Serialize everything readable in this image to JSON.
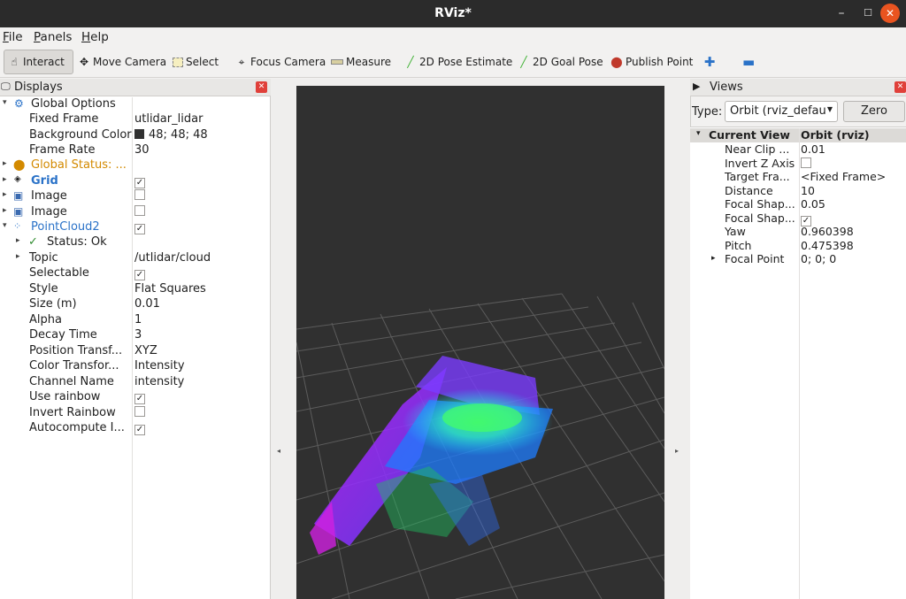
{
  "window": {
    "title": "RViz*"
  },
  "menu": [
    "File",
    "Panels",
    "Help"
  ],
  "toolbar": {
    "interact": "Interact",
    "move_camera": "Move Camera",
    "select": "Select",
    "focus_camera": "Focus Camera",
    "measure": "Measure",
    "pose_estimate": "2D Pose Estimate",
    "goal_pose": "2D Goal Pose",
    "publish_point": "Publish Point"
  },
  "displays": {
    "title": "Displays",
    "global_options": "Global Options",
    "fixed_frame_label": "Fixed Frame",
    "fixed_frame": "utlidar_lidar",
    "background_color_label": "Background Color",
    "background_color": "48; 48; 48",
    "frame_rate_label": "Frame Rate",
    "frame_rate": "30",
    "global_status": "Global Status: ...",
    "grid": "Grid",
    "image1": "Image",
    "image2": "Image",
    "pointcloud": "PointCloud2",
    "status": "Status: Ok",
    "topic_label": "Topic",
    "topic": "/utlidar/cloud",
    "selectable_label": "Selectable",
    "style_label": "Style",
    "style": "Flat Squares",
    "size_label": "Size (m)",
    "size": "0.01",
    "alpha_label": "Alpha",
    "alpha": "1",
    "decay_label": "Decay Time",
    "decay": "3",
    "position_label": "Position Transf...",
    "position": "XYZ",
    "color_label": "Color Transfor...",
    "color": "Intensity",
    "channel_label": "Channel Name",
    "channel": "intensity",
    "use_rainbow_label": "Use rainbow",
    "invert_rainbow_label": "Invert Rainbow",
    "autocompute_label": "Autocompute I..."
  },
  "views": {
    "title": "Views",
    "type_label": "Type:",
    "type_value": "Orbit (rviz_defau",
    "zero": "Zero",
    "current_view": "Current View",
    "current_view_type": "Orbit (rviz)",
    "rows": [
      {
        "label": "Near Clip ...",
        "value": "0.01"
      },
      {
        "label": "Invert Z Axis",
        "value": ""
      },
      {
        "label": "Target Fra...",
        "value": "<Fixed Frame>"
      },
      {
        "label": "Distance",
        "value": "10"
      },
      {
        "label": "Focal Shap...",
        "value": "0.05"
      },
      {
        "label": "Focal Shap...",
        "value": ""
      },
      {
        "label": "Yaw",
        "value": "0.960398"
      },
      {
        "label": "Pitch",
        "value": "0.475398"
      },
      {
        "label": "Focal Point",
        "value": "0; 0; 0"
      }
    ]
  },
  "colors": {
    "accent": "#2a72c8",
    "viewport_bg": "#303030",
    "close": "#e95420"
  }
}
